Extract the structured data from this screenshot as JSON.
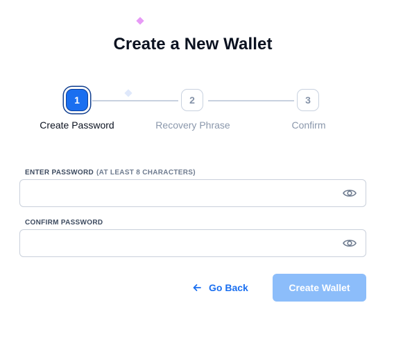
{
  "page": {
    "title": "Create a New Wallet"
  },
  "stepper": {
    "steps": [
      {
        "number": "1",
        "label": "Create Password",
        "state": "active"
      },
      {
        "number": "2",
        "label": "Recovery Phrase",
        "state": "inactive"
      },
      {
        "number": "3",
        "label": "Confirm",
        "state": "inactive"
      }
    ]
  },
  "form": {
    "password": {
      "label": "ENTER PASSWORD",
      "hint": "(AT LEAST 8 CHARACTERS)",
      "value": "",
      "icon": "eye-icon"
    },
    "confirm": {
      "label": "CONFIRM PASSWORD",
      "value": "",
      "icon": "eye-icon"
    }
  },
  "actions": {
    "back_label": "Go Back",
    "back_icon": "arrow-left-icon",
    "create_label": "Create Wallet",
    "create_enabled": false
  },
  "colors": {
    "accent": "#1a6ff0",
    "button_disabled": "#8cbdfa",
    "sparkle_pink": "#e79af6"
  }
}
